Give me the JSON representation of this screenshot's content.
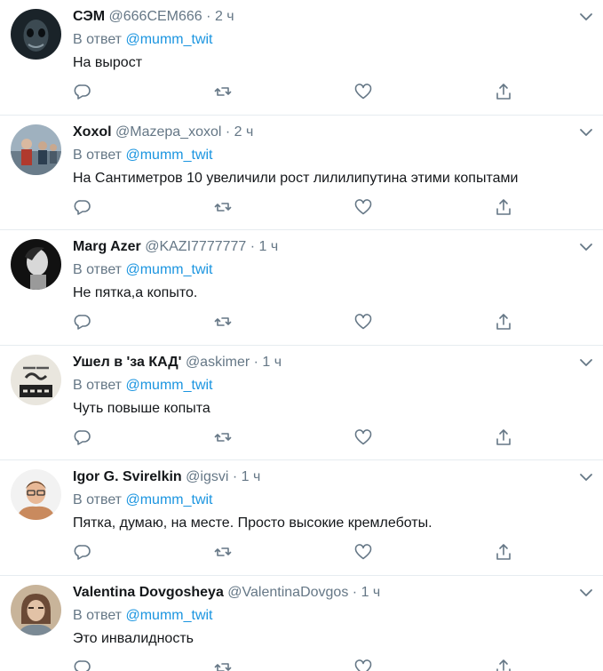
{
  "reply_prefix": "В ответ",
  "reply_to": "@mumm_twit",
  "tweets": [
    {
      "name": "СЭМ",
      "handle": "@666CEM666",
      "dot": "·",
      "time": "2 ч",
      "text": "На вырост",
      "avatar_icon": "dark-mask-avatar-icon",
      "avatar_colors": [
        "#1a2329",
        "#8a9aa3"
      ]
    },
    {
      "name": "Xoxol",
      "handle": "@Mazepa_xoxol",
      "dot": "·",
      "time": "2 ч",
      "text": "На Сантиметров 10 увеличили рост лилилипутина этими копытами",
      "avatar_icon": "crowd-photo-avatar-icon",
      "avatar_colors": [
        "#6a7c8a",
        "#b03a2e"
      ]
    },
    {
      "name": "Marg Azer",
      "handle": "@KAZI7777777",
      "dot": "·",
      "time": "1 ч",
      "text": "Не пятка,а копыто.",
      "avatar_icon": "portrait-bw-avatar-icon",
      "avatar_colors": [
        "#111111",
        "#d8d8d8"
      ]
    },
    {
      "name": "Ушел в 'за КАД'",
      "handle": "@askimer",
      "dot": "·",
      "time": "1 ч",
      "text": "Чуть повыше копыта",
      "avatar_icon": "text-badge-avatar-icon",
      "avatar_colors": [
        "#e9e6de",
        "#222222"
      ]
    },
    {
      "name": "Igor G. Svirelkin",
      "handle": "@igsvi",
      "dot": "·",
      "time": "1 ч",
      "text": "Пятка, думаю, на месте. Просто высокие кремлеботы.",
      "avatar_icon": "man-glasses-avatar-icon",
      "avatar_colors": [
        "#f2f2f2",
        "#c98a5e"
      ]
    },
    {
      "name": "Valentina Dovgosheya",
      "handle": "@ValentinaDovgos",
      "dot": "·",
      "time": "1 ч",
      "text": "Это инвалидность",
      "avatar_icon": "woman-photo-avatar-icon",
      "avatar_colors": [
        "#c8b49a",
        "#6b4a36"
      ]
    }
  ],
  "colors": {
    "link": "#1b95e0",
    "muted": "#657786",
    "text": "#14171a",
    "divider": "#e6ecf0"
  }
}
